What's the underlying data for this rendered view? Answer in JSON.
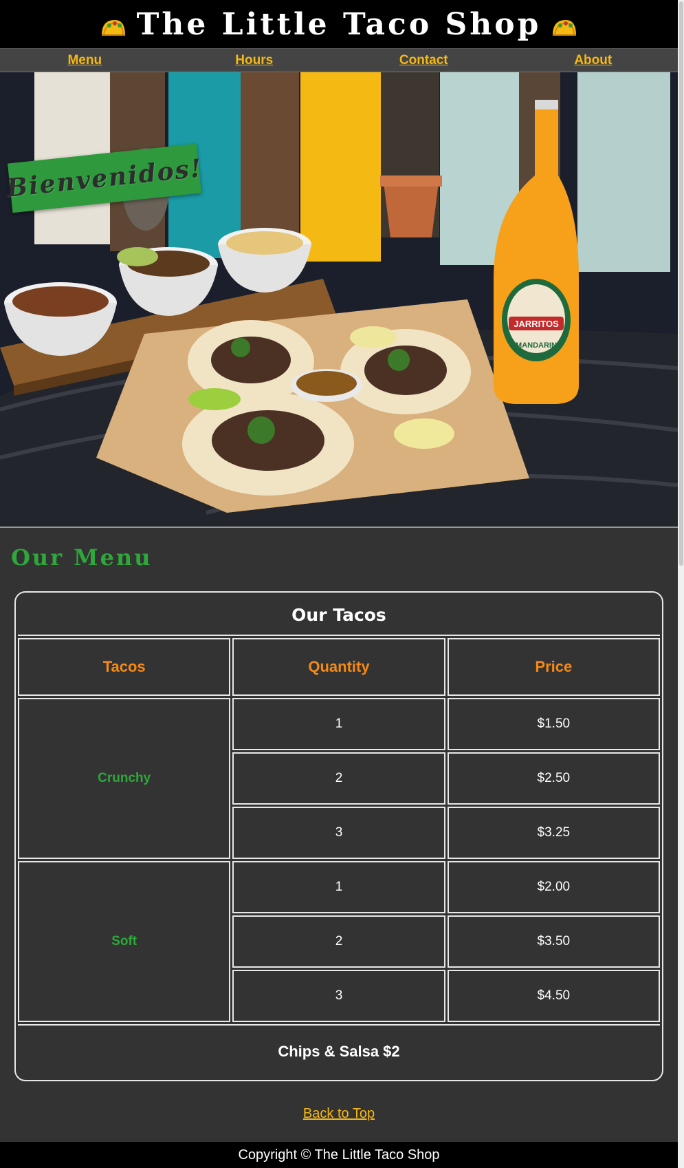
{
  "header": {
    "title": "The Little Taco Shop",
    "left_icon": "taco-icon",
    "right_icon": "taco-icon"
  },
  "nav": {
    "items": [
      {
        "label": "Menu"
      },
      {
        "label": "Hours"
      },
      {
        "label": "Contact"
      },
      {
        "label": "About"
      }
    ]
  },
  "hero": {
    "banner_text": "Bienvenidos!",
    "bottle_label_top": "JARRITOS",
    "bottle_label_flavor": "MANDARIN"
  },
  "menu": {
    "section_title": "Our Menu",
    "table_caption": "Our Tacos",
    "columns": [
      "Tacos",
      "Quantity",
      "Price"
    ],
    "groups": [
      {
        "type": "Crunchy",
        "rows": [
          {
            "quantity": "1",
            "price": "$1.50"
          },
          {
            "quantity": "2",
            "price": "$2.50"
          },
          {
            "quantity": "3",
            "price": "$3.25"
          }
        ]
      },
      {
        "type": "Soft",
        "rows": [
          {
            "quantity": "1",
            "price": "$2.00"
          },
          {
            "quantity": "2",
            "price": "$3.50"
          },
          {
            "quantity": "3",
            "price": "$4.50"
          }
        ]
      }
    ],
    "footer_note": "Chips & Salsa $2"
  },
  "back_to_top": "Back to Top",
  "footer": {
    "copyright": "Copyright © The Little Taco Shop"
  },
  "colors": {
    "background": "#333333",
    "header": "#000000",
    "nav_link": "#f5b914",
    "accent_green": "#2ea83a",
    "column_header_orange": "#f58a14"
  }
}
